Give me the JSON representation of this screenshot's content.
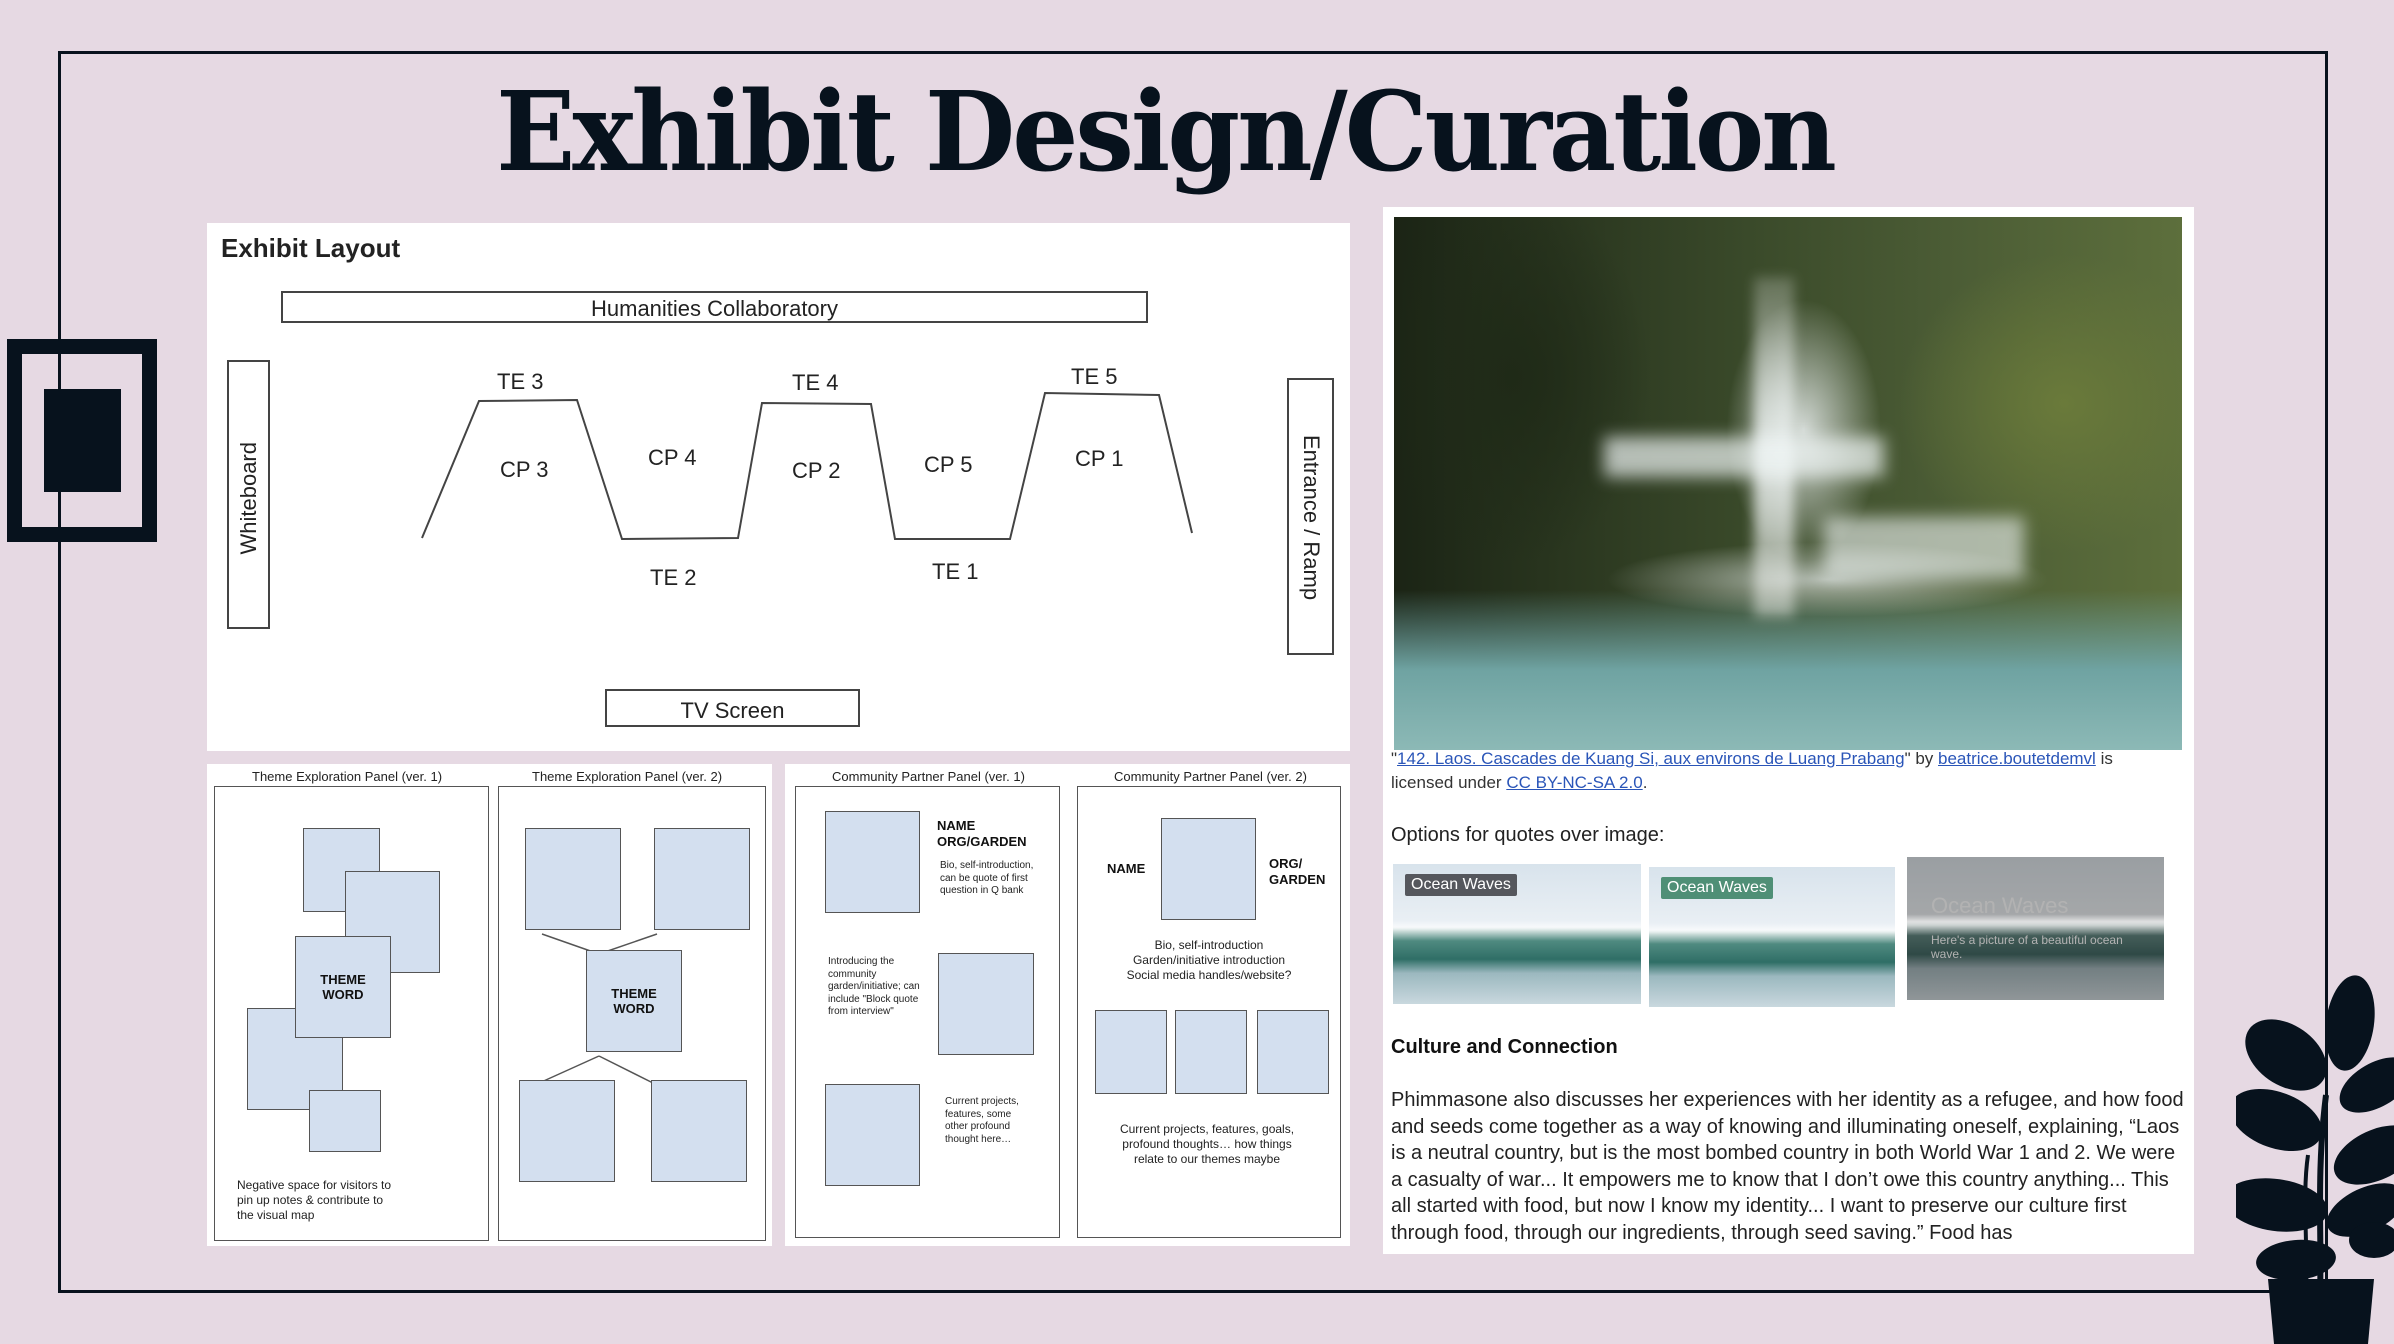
{
  "slide": {
    "title": "Exhibit Design/Curation",
    "colors": {
      "background": "#e6d9e3",
      "ink": "#07121d",
      "link": "#2a55b8",
      "panel_box": "#d3dfef"
    }
  },
  "exhibit_layout": {
    "title": "Exhibit Layout",
    "humanities": "Humanities Collaboratory",
    "whiteboard": "Whiteboard",
    "entrance": "Entrance / Ramp",
    "tv": "TV Screen",
    "te": [
      "TE 3",
      "TE 4",
      "TE 5",
      "TE 2",
      "TE 1"
    ],
    "cp": [
      "CP 3",
      "CP 4",
      "CP 2",
      "CP 5",
      "CP 1"
    ]
  },
  "theme_panels": {
    "v1_caption": "Theme Exploration Panel (ver. 1)",
    "v2_caption": "Theme Exploration Panel (ver. 2)",
    "theme_word_line1": "THEME",
    "theme_word_line2": "WORD",
    "negative_space_note": "Negative space for visitors to pin up notes & contribute to the visual map"
  },
  "community_panels": {
    "v1_caption": "Community Partner Panel (ver. 1)",
    "v2_caption": "Community Partner Panel (ver. 2)",
    "v1": {
      "name": "NAME",
      "org": "ORG/GARDEN",
      "bio": "Bio, self-introduction, can be quote of first question in Q bank",
      "intro": "Introducing the community garden/initiative; can include \"Block quote from interview\"",
      "projects": "Current projects, features, some other profound thought here…"
    },
    "v2": {
      "name": "NAME",
      "org_line1": "ORG/",
      "org_line2": "GARDEN",
      "bio_line1": "Bio, self-introduction",
      "bio_line2": "Garden/initiative introduction",
      "bio_line3": "Social media handles/website?",
      "projects": "Current projects, features, goals, profound thoughts… how things relate to our themes maybe"
    }
  },
  "doc": {
    "photo_alt": "Waterfall cascades in a jungle with turquoise pools",
    "credit": {
      "quote_open": "\"",
      "title_link": "142. Laos. Cascades de Kuang Si, aux environs de Luang Prabang",
      "by": "\" by ",
      "author_link": "beatrice.boutetdemvl",
      "is": " is",
      "licensed": "licensed under ",
      "license_link": "CC BY-NC-SA 2.0",
      "period": "."
    },
    "options_label": "Options for quotes over image:",
    "options": [
      {
        "tag": "Ocean Waves",
        "tag_color": "#55575d"
      },
      {
        "tag": "Ocean Waves",
        "tag_color": "#4f8f76"
      },
      {
        "title": "Ocean Waves",
        "subtitle": "Here's a picture of a beautiful ocean wave."
      }
    ],
    "section_heading": "Culture and Connection",
    "paragraph": "Phimmasone also discusses her experiences with her identity as a refugee, and how food and seeds come together as a way of knowing and illuminating oneself, explaining, “Laos is a neutral country, but is the most bombed country in both World War 1 and 2. We were a casualty of war... It empowers me to know that I don’t owe this country anything... This all started with food, but now I know my identity... I want to preserve our culture first through food, through our ingredients, through seed saving.” Food has"
  }
}
